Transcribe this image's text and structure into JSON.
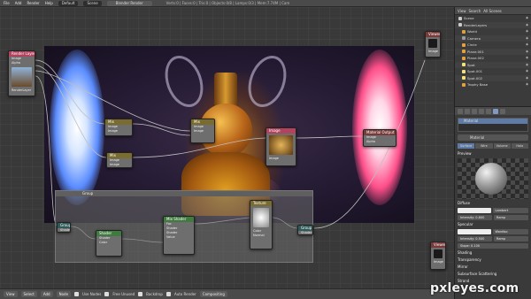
{
  "topbar": {
    "menus": [
      "File",
      "Add",
      "Render",
      "Help"
    ],
    "layout": "Default",
    "scene": "Scene",
    "engine": "Blender Render",
    "info": "Verts:0 | Faces:0 | Tris:0 | Objects:0/8 | Lamps:0/3 | Mem:7.74M | Cam"
  },
  "nodes": {
    "render_layers": {
      "title": "Render Layers",
      "rows": [
        "Image",
        "Alpha",
        "Z",
        "Normal"
      ],
      "footer": "RenderLayer"
    },
    "mix1": {
      "title": "Mix",
      "rows": [
        "Image",
        "Image"
      ]
    },
    "mix2": {
      "title": "Mix",
      "rows": [
        "Image",
        "Image"
      ]
    },
    "mix3": {
      "title": "Mix",
      "rows": [
        "Image",
        "Image"
      ]
    },
    "image_node": {
      "title": "Image",
      "rows": [
        "Image",
        "Alpha"
      ]
    },
    "output": {
      "title": "Material Output",
      "rows": [
        "Image",
        "Alpha"
      ]
    },
    "group_in": {
      "title": "Group",
      "rows": [
        "Shader"
      ]
    },
    "shader": {
      "title": "Shader",
      "rows": [
        "Shader",
        "Color"
      ]
    },
    "mix_shader": {
      "title": "Mix Shader",
      "rows": [
        "Fac",
        "Shader",
        "Shader",
        "Value"
      ]
    },
    "texture": {
      "title": "Texture",
      "rows": [
        "Color",
        "Normal"
      ]
    },
    "group_out": {
      "title": "Group",
      "rows": [
        "Shader"
      ]
    },
    "corner_node": {
      "title": "Viewer",
      "rows": [
        "Image"
      ]
    },
    "corner_node2": {
      "title": "Viewer",
      "rows": [
        "Image"
      ]
    }
  },
  "frame": {
    "label": "Group"
  },
  "bottombar": {
    "items": [
      "View",
      "Select",
      "Add",
      "Node"
    ],
    "use_nodes": "Use Nodes",
    "free_unused": "Free Unused",
    "backdrop": "Backdrop",
    "auto_render": "Auto Render",
    "compositing": "Compositing"
  },
  "outliner": {
    "header": [
      "View",
      "Search",
      "All Scenes"
    ],
    "items": [
      {
        "label": "Scene",
        "icon_color": "#cccccc"
      },
      {
        "label": "RenderLayers",
        "icon_color": "#cccccc"
      },
      {
        "label": "World",
        "icon_color": "#d9a23f"
      },
      {
        "label": "Camera",
        "icon_color": "#9a9a9a"
      },
      {
        "label": "Circle",
        "icon_color": "#e5a040"
      },
      {
        "label": "Plane.001",
        "icon_color": "#e5a040"
      },
      {
        "label": "Plane.002",
        "icon_color": "#e5a040"
      },
      {
        "label": "Spot",
        "icon_color": "#f2e27a"
      },
      {
        "label": "Spot.001",
        "icon_color": "#f2e27a"
      },
      {
        "label": "Spot.002",
        "icon_color": "#f2e27a"
      },
      {
        "label": "Trophy Base",
        "icon_color": "#e5a040"
      }
    ]
  },
  "properties": {
    "material_slot": "Material",
    "material_name": "Material",
    "sub_tabs": [
      "Surface",
      "Wire",
      "Volume",
      "Halo"
    ],
    "sections": {
      "preview": "Preview",
      "diffuse": "Diffuse",
      "specular": "Specular",
      "shading": "Shading",
      "transparency": "Transparency",
      "mirror": "Mirror",
      "sss": "Subsurface Scattering",
      "strand": "Strand"
    },
    "diffuse_shader": "Lambert",
    "diffuse_intensity": "Intensity: 0.800",
    "ramp": "Ramp",
    "spec_shader": "WardIso",
    "spec_intensity": "Intensity: 0.500",
    "slope": "Slope: 0.100"
  },
  "watermark": "pxleyes.com"
}
